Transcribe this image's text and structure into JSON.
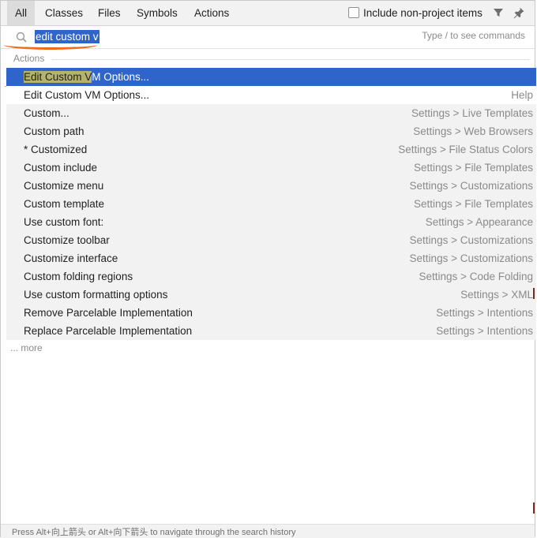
{
  "tabs": [
    {
      "label": "All",
      "active": true
    },
    {
      "label": "Classes",
      "active": false
    },
    {
      "label": "Files",
      "active": false
    },
    {
      "label": "Symbols",
      "active": false
    },
    {
      "label": "Actions",
      "active": false
    }
  ],
  "include_non_project": {
    "label": "Include non-project items",
    "checked": false
  },
  "icons": {
    "filter": "filter-icon",
    "pin": "pin-icon",
    "search": "search-icon"
  },
  "search": {
    "value": "edit custom v",
    "hint": "Type / to see commands"
  },
  "section": {
    "title": "Actions"
  },
  "results": [
    {
      "label_hl": "Edit Custom V",
      "label_rest": "M Options...",
      "path": "",
      "selected": true
    },
    {
      "label": "Edit Custom VM Options...",
      "path": "Help"
    },
    {
      "label": "Custom...",
      "path": "Settings > Live Templates"
    },
    {
      "label": "Custom path",
      "path": "Settings > Web Browsers"
    },
    {
      "label": "* Customized",
      "path": "Settings > File Status Colors"
    },
    {
      "label": "Custom include",
      "path": "Settings > File Templates"
    },
    {
      "label": "Customize menu",
      "path": "Settings > Customizations"
    },
    {
      "label": "Custom template",
      "path": "Settings > File Templates"
    },
    {
      "label": "Use custom font:",
      "path": "Settings > Appearance"
    },
    {
      "label": "Customize toolbar",
      "path": "Settings > Customizations"
    },
    {
      "label": "Customize interface",
      "path": "Settings > Customizations"
    },
    {
      "label": "Custom folding regions",
      "path": "Settings > Code Folding"
    },
    {
      "label": "Use custom formatting options",
      "path": "Settings > XML"
    },
    {
      "label": "Remove Parcelable Implementation",
      "path": "Settings > Intentions"
    },
    {
      "label": "Replace Parcelable Implementation",
      "path": "Settings > Intentions"
    }
  ],
  "more_label": "... more",
  "footer": {
    "text": "Press Alt+向上箭头 or Alt+向下箭头 to navigate through the search history"
  },
  "colors": {
    "selection": "#2f65ca",
    "highlight": "#b8b36b",
    "annotation": "#f26b1d"
  }
}
